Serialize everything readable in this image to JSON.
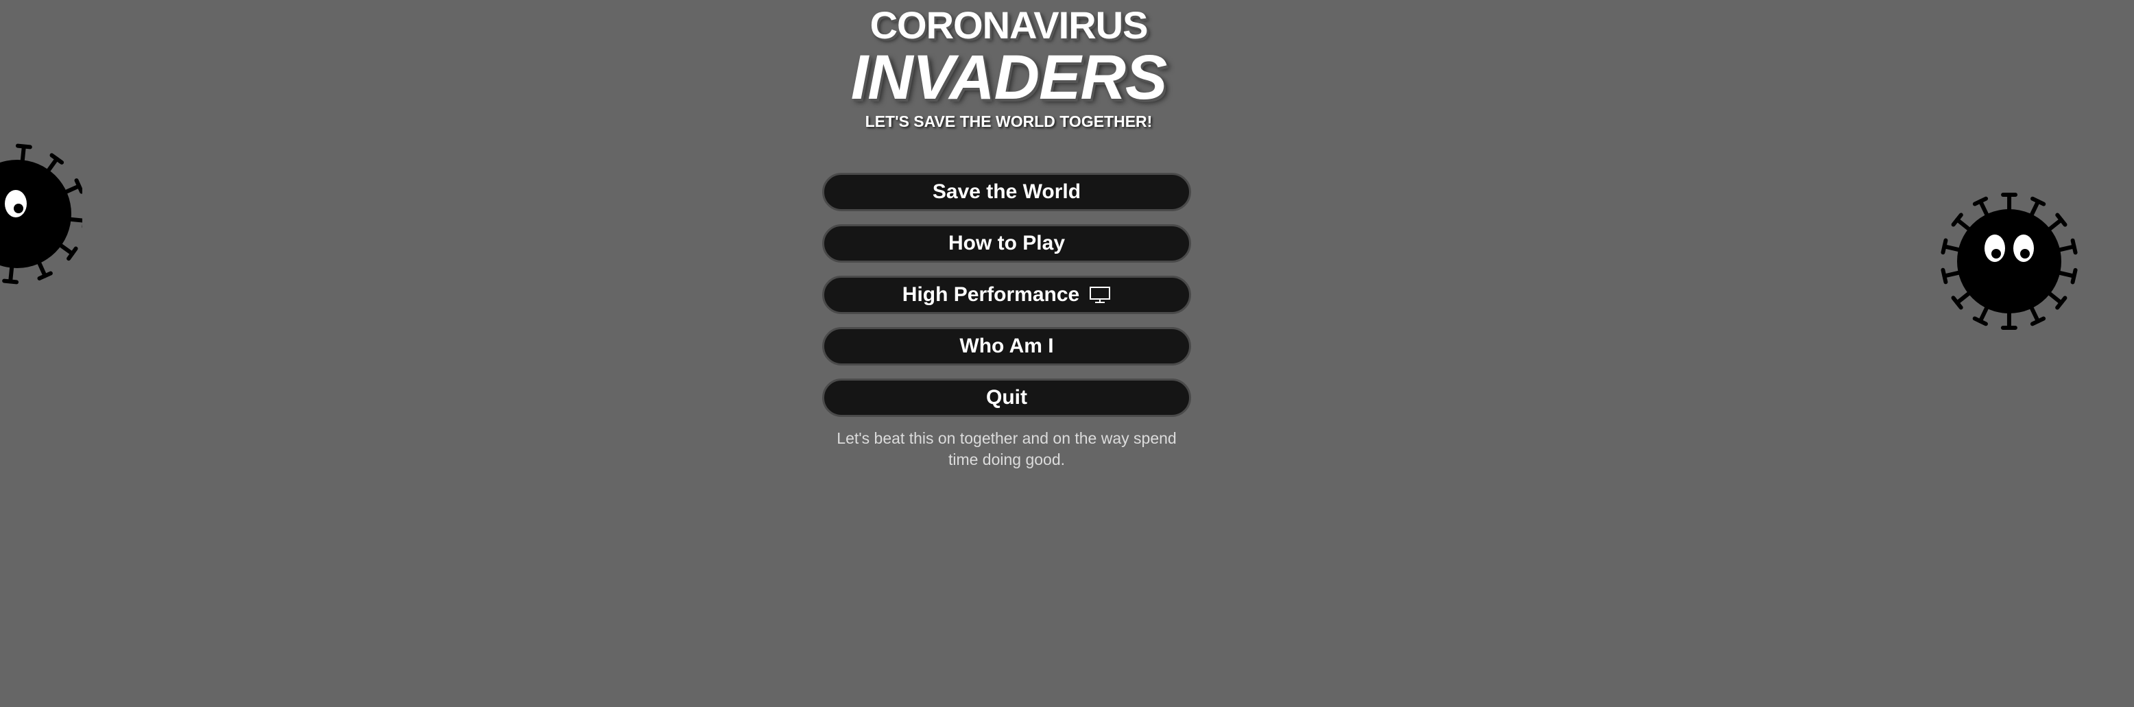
{
  "title": {
    "line1": "CORONAVIRUS",
    "line2": "INVADERS",
    "tagline": "LET'S SAVE THE WORLD TOGETHER!"
  },
  "menu": {
    "items": [
      {
        "label": "Save the World"
      },
      {
        "label": "How to Play"
      },
      {
        "label": "High Performance",
        "icon": "monitor-icon"
      },
      {
        "label": "Who Am I"
      },
      {
        "label": "Quit"
      }
    ]
  },
  "footer": {
    "text": "Let's beat this on together and on the way spend time doing good."
  },
  "colors": {
    "background": "#666666",
    "button": "#151515",
    "button_border": "#4a4a4a",
    "text": "#ffffff",
    "subtitle": "#dcdcdc",
    "virus": "#000000"
  }
}
